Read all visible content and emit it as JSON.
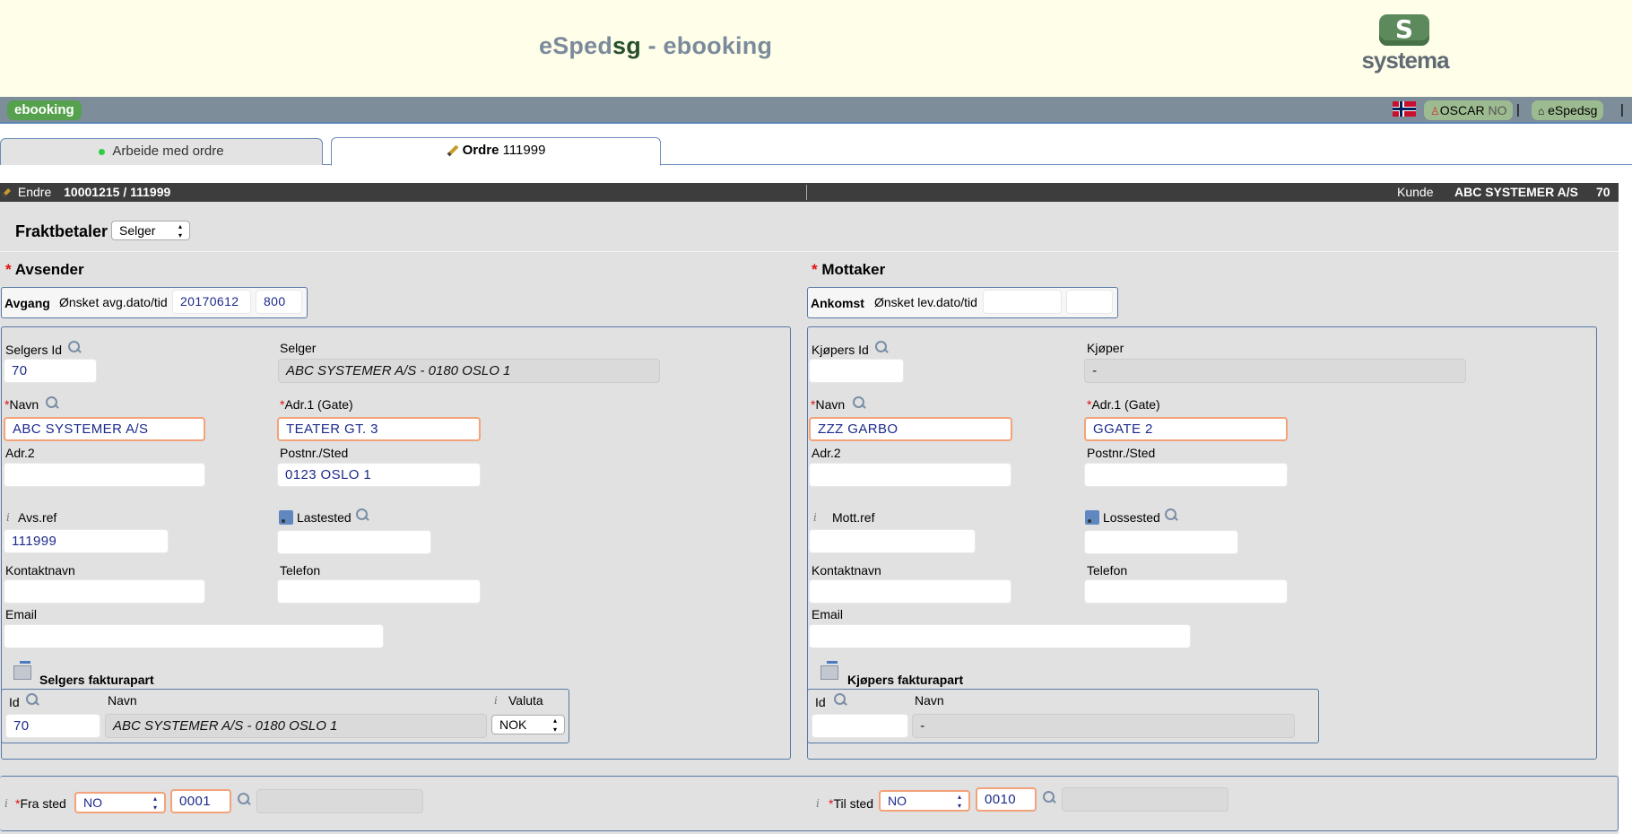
{
  "header": {
    "title_prefix": "eSped",
    "title_sg": "sg",
    "title_suffix": " - ebooking",
    "logo_mark": "S",
    "logo_text": "systema"
  },
  "topbar": {
    "module": "ebooking",
    "user_name": "OSCAR",
    "user_lang": "NO",
    "home_link": "eSpedsg",
    "separator": "|"
  },
  "tabs": [
    {
      "label": "Arbeide med ordre"
    },
    {
      "label": "Ordre",
      "number": "111999"
    }
  ],
  "titlebar": {
    "action": "Endre",
    "order_ref": "10001215 / 111999",
    "kunde_label": "Kunde",
    "kunde_name": "ABC SYSTEMER A/S",
    "kunde_no": "70"
  },
  "fraktbetaler": {
    "label": "Fraktbetaler",
    "value": "Selger"
  },
  "sender": {
    "section_title": "Avsender",
    "avgang": {
      "label": "Avgang",
      "date_label": "Ønsket avg.dato/tid",
      "date": "20170612",
      "time": "800"
    },
    "id_label": "Selgers Id",
    "id": "70",
    "party_label": "Selger",
    "party": "ABC SYSTEMER A/S - 0180 OSLO 1",
    "navn_label": "Navn",
    "navn": "ABC SYSTEMER A/S",
    "adr1_label": "Adr.1 (Gate)",
    "adr1": "TEATER GT. 3",
    "adr2_label": "Adr.2",
    "adr2": "",
    "postnr_label": "Postnr./Sted",
    "postnr": "0123 OSLO 1",
    "ref_label": "Avs.ref",
    "ref": "111999",
    "place_label": "Lastested",
    "place": "",
    "kontakt_label": "Kontaktnavn",
    "kontakt": "",
    "telefon_label": "Telefon",
    "telefon": "",
    "email_label": "Email",
    "email": "",
    "faktura": {
      "title": "Selgers fakturapart",
      "id_label": "Id",
      "id": "70",
      "navn_label": "Navn",
      "navn": "ABC SYSTEMER A/S - 0180 OSLO 1",
      "valuta_label": "Valuta",
      "valuta": "NOK"
    }
  },
  "receiver": {
    "section_title": "Mottaker",
    "ankomst": {
      "label": "Ankomst",
      "date_label": "Ønsket lev.dato/tid",
      "date": "",
      "time": ""
    },
    "id_label": "Kjøpers Id",
    "id": "",
    "party_label": "Kjøper",
    "party": "-",
    "navn_label": "Navn",
    "navn": "ZZZ GARBO",
    "adr1_label": "Adr.1 (Gate)",
    "adr1": "GGATE 2",
    "adr2_label": "Adr.2",
    "adr2": "",
    "postnr_label": "Postnr./Sted",
    "postnr": "",
    "ref_label": "Mott.ref",
    "ref": "",
    "place_label": "Lossested",
    "place": "",
    "kontakt_label": "Kontaktnavn",
    "kontakt": "",
    "telefon_label": "Telefon",
    "telefon": "",
    "email_label": "Email",
    "email": "",
    "faktura": {
      "title": "Kjøpers fakturapart",
      "id_label": "Id",
      "id": "",
      "navn_label": "Navn",
      "navn": "-"
    }
  },
  "route": {
    "fra_label": "Fra sted",
    "fra_country": "NO",
    "fra_postnr": "0001",
    "fra_place": "",
    "til_label": "Til sted",
    "til_country": "NO",
    "til_postnr": "0010",
    "til_place": ""
  },
  "colors": {
    "header_bg": "#fefee9",
    "topbar_bg": "#7d8d99",
    "accent_green": "#55a14d",
    "required": "#e01010",
    "input_border_required": "#f3a27a"
  }
}
